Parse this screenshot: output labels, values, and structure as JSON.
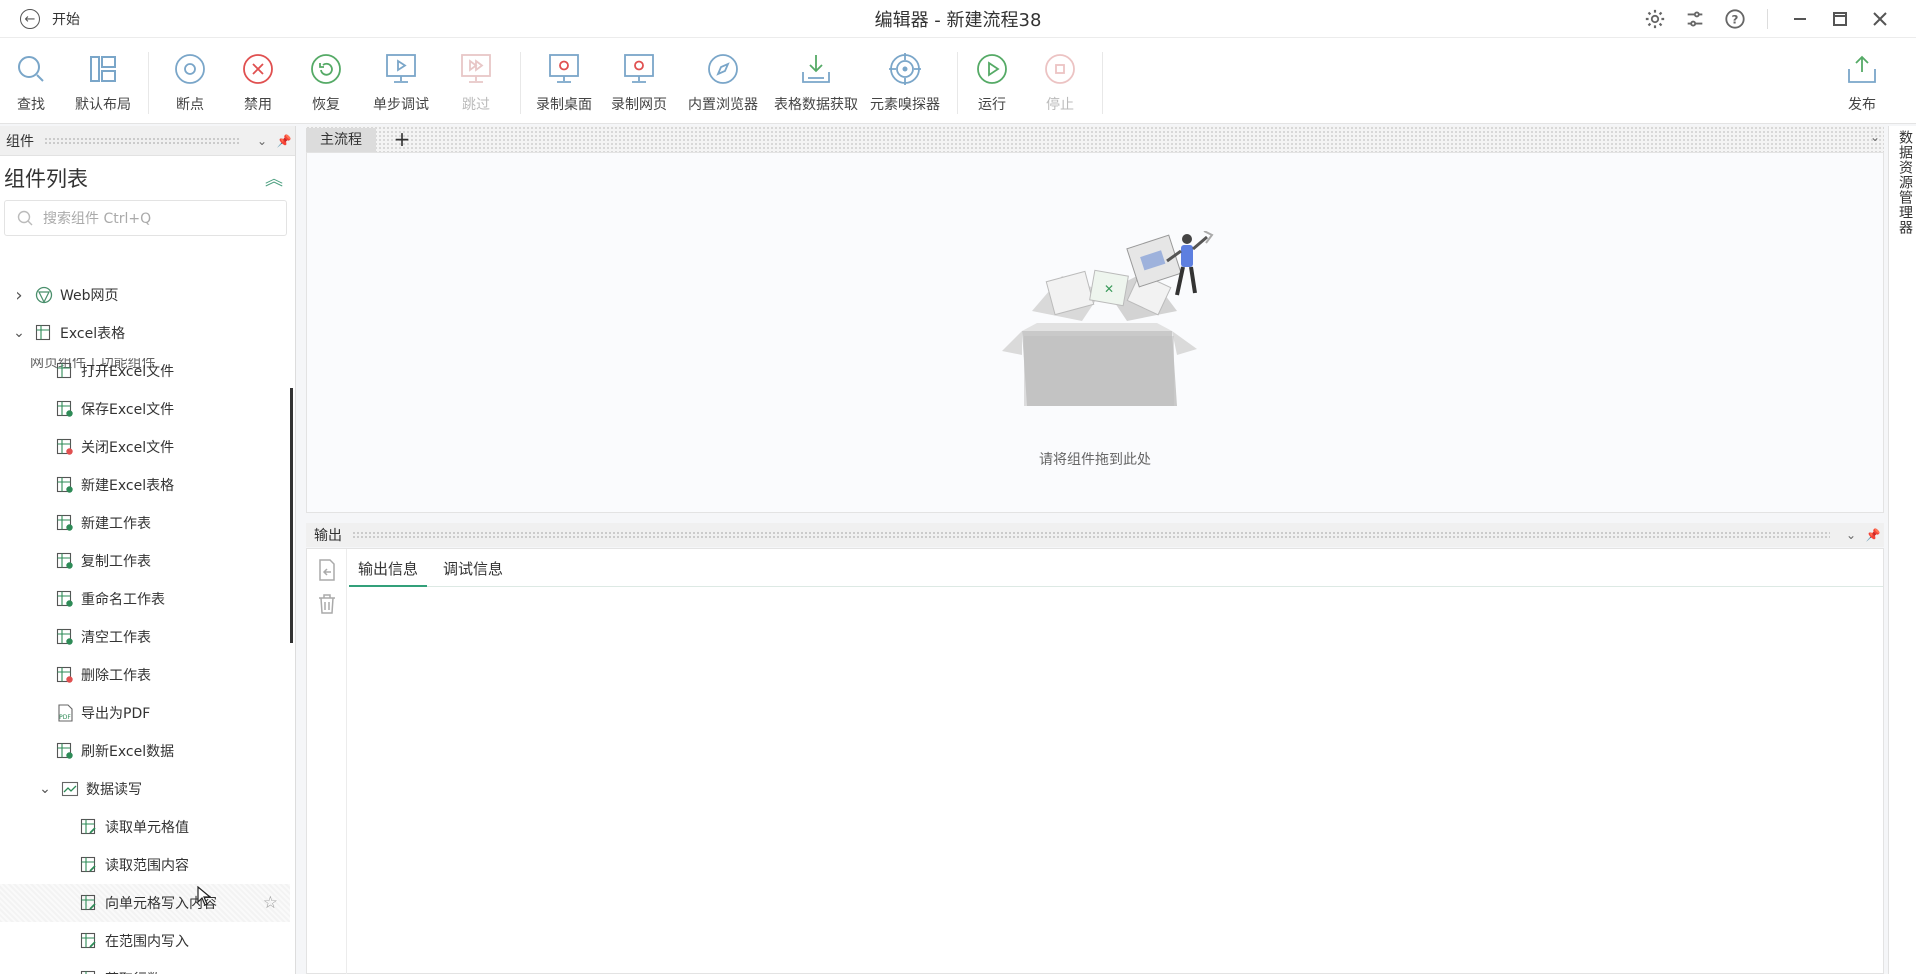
{
  "titlebar": {
    "back_label": "开始",
    "title": "编辑器 - 新建流程38"
  },
  "toolbar": {
    "items": [
      {
        "label": "查找",
        "icon": "search-icon"
      },
      {
        "label": "默认布局",
        "icon": "layout-icon"
      },
      {
        "label": "断点",
        "icon": "breakpoint-icon"
      },
      {
        "label": "禁用",
        "icon": "disable-icon"
      },
      {
        "label": "恢复",
        "icon": "restore-icon"
      },
      {
        "label": "单步调试",
        "icon": "step-debug-icon"
      },
      {
        "label": "跳过",
        "icon": "skip-icon",
        "disabled": true
      },
      {
        "label": "录制桌面",
        "icon": "record-desktop-icon"
      },
      {
        "label": "录制网页",
        "icon": "record-web-icon"
      },
      {
        "label": "内置浏览器",
        "icon": "browser-icon"
      },
      {
        "label": "表格数据获取",
        "icon": "table-fetch-icon"
      },
      {
        "label": "元素嗅探器",
        "icon": "element-sniffer-icon"
      },
      {
        "label": "运行",
        "icon": "run-icon"
      },
      {
        "label": "停止",
        "icon": "stop-icon",
        "disabled": true
      },
      {
        "label": "发布",
        "icon": "publish-icon"
      }
    ]
  },
  "left_panel": {
    "header": "组件",
    "title": "组件列表",
    "search_placeholder": "搜索组件 Ctrl+Q",
    "partial_row": "网页组件   |   功能组件",
    "tree": [
      {
        "label": "Web网页",
        "level": 0,
        "arrow": "›",
        "icon": "web-icon"
      },
      {
        "label": "Excel表格",
        "level": 0,
        "arrow": "⌄",
        "icon": "excel-icon"
      },
      {
        "label": "打开Excel文件",
        "level": 1,
        "icon": "open-excel-icon"
      },
      {
        "label": "保存Excel文件",
        "level": 1,
        "icon": "save-excel-icon"
      },
      {
        "label": "关闭Excel文件",
        "level": 1,
        "icon": "close-excel-icon"
      },
      {
        "label": "新建Excel表格",
        "level": 1,
        "icon": "new-excel-icon"
      },
      {
        "label": "新建工作表",
        "level": 1,
        "icon": "new-sheet-icon"
      },
      {
        "label": "复制工作表",
        "level": 1,
        "icon": "copy-sheet-icon"
      },
      {
        "label": "重命名工作表",
        "level": 1,
        "icon": "rename-sheet-icon"
      },
      {
        "label": "清空工作表",
        "level": 1,
        "icon": "clear-sheet-icon"
      },
      {
        "label": "删除工作表",
        "level": 1,
        "icon": "delete-sheet-icon"
      },
      {
        "label": "导出为PDF",
        "level": 1,
        "icon": "pdf-icon"
      },
      {
        "label": "刷新Excel数据",
        "level": 1,
        "icon": "refresh-excel-icon"
      },
      {
        "label": "数据读写",
        "level": 1,
        "arrow": "⌄",
        "icon": "data-rw-icon"
      },
      {
        "label": "读取单元格值",
        "level": 2,
        "icon": "read-cell-icon"
      },
      {
        "label": "读取范围内容",
        "level": 2,
        "icon": "read-range-icon"
      },
      {
        "label": "向单元格写入内容",
        "level": 2,
        "icon": "write-cell-icon",
        "highlight": true
      },
      {
        "label": "在范围内写入",
        "level": 2,
        "icon": "write-range-icon"
      },
      {
        "label": "获取行数",
        "level": 2,
        "icon": "row-count-icon"
      }
    ]
  },
  "main": {
    "tabs": [
      "主流程"
    ],
    "add_tab": "+",
    "empty_hint": "请将组件拖到此处"
  },
  "right_bar": {
    "label": "数据资源管理器"
  },
  "output": {
    "header": "输出",
    "tabs": [
      "输出信息",
      "调试信息"
    ],
    "active_tab": 0
  },
  "colors": {
    "accent": "#33a07a",
    "excel_green": "#2e8b57",
    "icon_red": "#e05050"
  }
}
